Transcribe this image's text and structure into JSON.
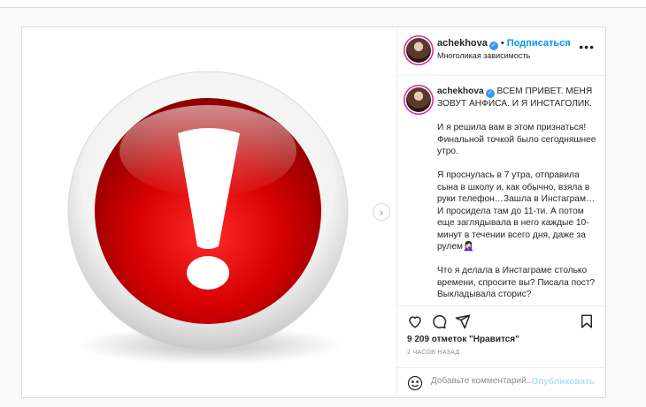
{
  "colors": {
    "accent": "#0095f6",
    "verified": "#3897f0",
    "publish_disabled": "#b2dffc",
    "text": "#262626",
    "muted": "#8e8e8e"
  },
  "media": {
    "image": "red-exclamation-button",
    "next_icon": "chevron-right-icon"
  },
  "header": {
    "username": "achekhova",
    "separator": "•",
    "follow_label": "Подписаться",
    "subtitle": "Многоликая зависимость",
    "more_icon": "more-horizontal-icon",
    "more_label": "•••"
  },
  "caption": {
    "username": "achekhova",
    "paragraphs": [
      "ВСЕМ ПРИВЕТ. МЕНЯ ЗОВУТ АНФИСА. И Я ИНСТАГОЛИК.",
      "И я решила вам в этом признаться! Финальной точкой было сегодняшнее утро.",
      "Я проснулась в 7 утра, отправила сына в школу и, как обычно, взяла в руки телефон…Зашла в Инстаграм… И просидела там до 11-ти. А потом еще заглядывала в него каждые 10-минут в течении всего дня, даже за рулем🤦🏻‍♀️",
      "Что я делала в Инстаграме столько времени, спросите вы? Писала пост? Выкладывала сторис?"
    ]
  },
  "actions": {
    "icons": [
      "heart-icon",
      "comment-icon",
      "share-icon",
      "bookmark-icon"
    ],
    "likes_text": "9 209 отметок \"Нравится\"",
    "time_text": "2 ЧАСОВ НАЗАД"
  },
  "comment": {
    "placeholder": "Добавьте комментарий...",
    "publish_label": "Опубликовать",
    "emoji_icon": "smiley-icon"
  }
}
